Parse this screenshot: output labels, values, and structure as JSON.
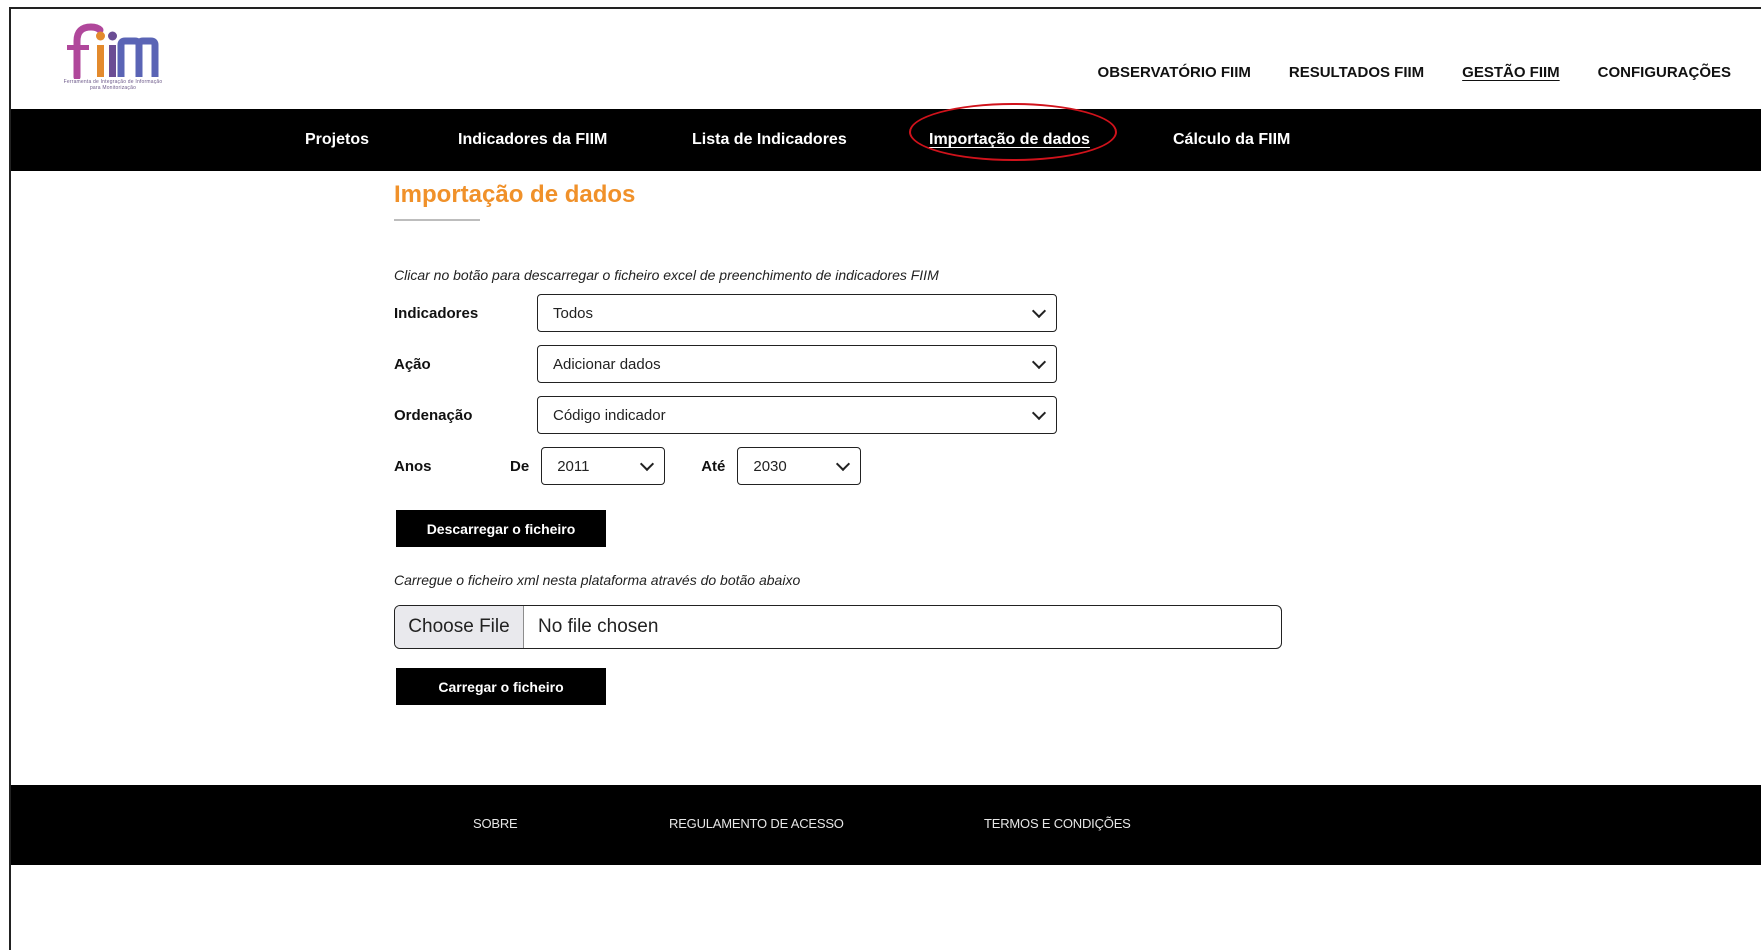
{
  "brand": {
    "logo_text": "fiim",
    "tagline": "Ferramenta de Integração de Informação para Monitorização",
    "colors": {
      "f": "#b0479b",
      "i1": "#e38a2d",
      "i2": "#6b4d94",
      "m": "#5a64b5"
    }
  },
  "topnav": {
    "items": [
      {
        "label": "OBSERVATÓRIO FIIM"
      },
      {
        "label": "RESULTADOS FIIM"
      },
      {
        "label": "GESTÃO FIIM",
        "active": true
      },
      {
        "label": "CONFIGURAÇÕES"
      }
    ]
  },
  "subnav": {
    "items": [
      {
        "label": "Projetos"
      },
      {
        "label": "Indicadores da FIIM"
      },
      {
        "label": "Lista de Indicadores"
      },
      {
        "label": "Importação de dados",
        "current": true
      },
      {
        "label": "Cálculo da FIIM"
      }
    ],
    "highlight_color": "#d0121b"
  },
  "main": {
    "title": "Importação de dados",
    "title_color": "#f0912a",
    "download_hint": "Clicar no botão para descarregar o ficheiro excel de preenchimento de indicadores FIIM",
    "fields": {
      "indicadores": {
        "label": "Indicadores",
        "value": "Todos"
      },
      "acao": {
        "label": "Ação",
        "value": "Adicionar dados"
      },
      "ordenacao": {
        "label": "Ordenação",
        "value": "Código indicador"
      },
      "anos": {
        "label": "Anos",
        "from_label": "De",
        "from_value": "2011",
        "to_label": "Até",
        "to_value": "2030"
      }
    },
    "download_button": "Descarregar o ficheiro",
    "upload_hint": "Carregue o ficheiro xml nesta plataforma através do botão abaixo",
    "file_input": {
      "button": "Choose File",
      "status": "No file chosen"
    },
    "upload_button": "Carregar o ficheiro"
  },
  "footer": {
    "links": [
      {
        "label": "SOBRE"
      },
      {
        "label": "REGULAMENTO DE ACESSO"
      },
      {
        "label": "TERMOS E CONDIÇÕES"
      }
    ]
  }
}
